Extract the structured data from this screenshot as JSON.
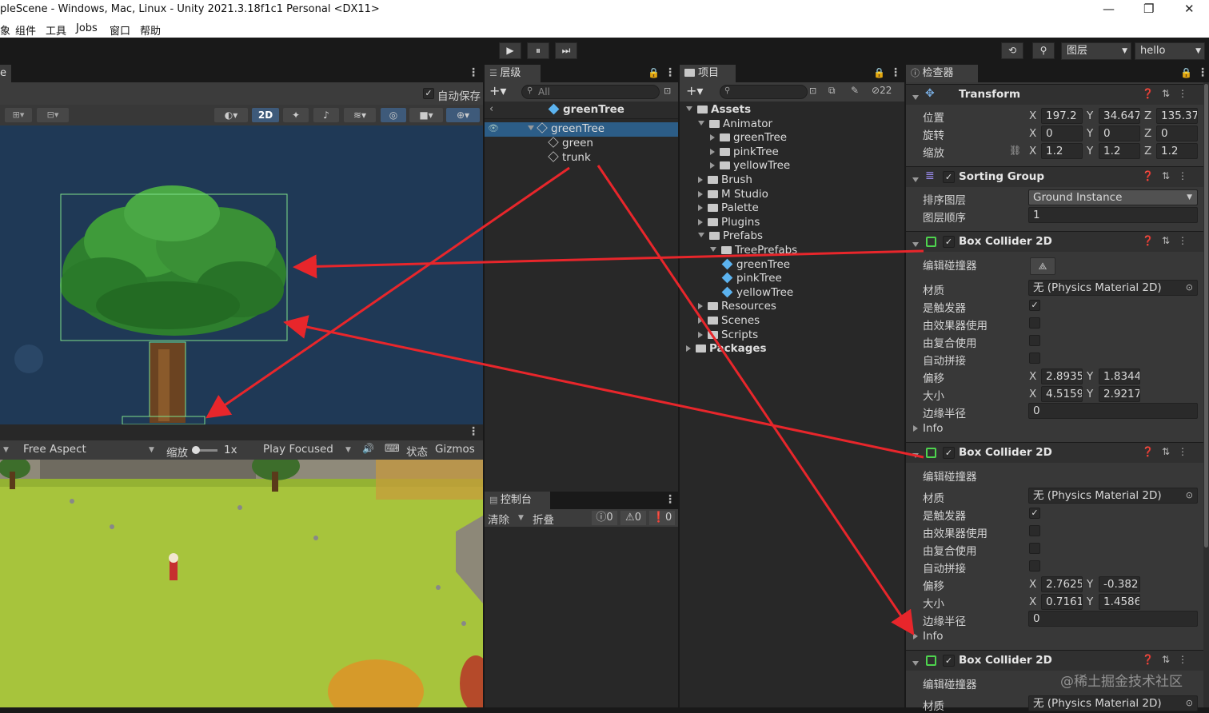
{
  "window": {
    "title": "pleScene - Windows, Mac, Linux - Unity 2021.3.18f1c1 Personal <DX11>",
    "minimize": "—",
    "restore": "❐",
    "close": "✕"
  },
  "menu": [
    "象",
    "组件",
    "工具",
    "Jobs",
    "窗口",
    "帮助"
  ],
  "toolbar": {
    "play": "▶",
    "pause": "⏸",
    "step": "⏭",
    "history": "⟲",
    "search": "⚲",
    "layers": "图层",
    "layout": "hello"
  },
  "scene": {
    "tab": "e",
    "autosave": "自动保存",
    "mode_2d": "2D"
  },
  "game": {
    "aspect": "Free Aspect",
    "scale_label": "缩放",
    "scale_value": "1x",
    "play_mode": "Play Focused",
    "stats": "状态",
    "gizmos": "Gizmos"
  },
  "hierarchy": {
    "tab": "层级",
    "search_placeholder": "All",
    "root": "greenTree",
    "items": [
      "greenTree",
      "green",
      "trunk"
    ]
  },
  "console": {
    "tab": "控制台",
    "clear": "清除",
    "collapse": "折叠",
    "info_count": "0",
    "warn_count": "0",
    "error_count": "0"
  },
  "project": {
    "tab": "项目",
    "hidden_count": "22",
    "tree": [
      {
        "label": "Assets",
        "depth": 0,
        "open": true,
        "bold": true
      },
      {
        "label": "Animator",
        "depth": 1,
        "open": true
      },
      {
        "label": "greenTree",
        "depth": 2
      },
      {
        "label": "pinkTree",
        "depth": 2
      },
      {
        "label": "yellowTree",
        "depth": 2
      },
      {
        "label": "Brush",
        "depth": 1
      },
      {
        "label": "M Studio",
        "depth": 1
      },
      {
        "label": "Palette",
        "depth": 1
      },
      {
        "label": "Plugins",
        "depth": 1
      },
      {
        "label": "Prefabs",
        "depth": 1,
        "open": true
      },
      {
        "label": "TreePrefabs",
        "depth": 2,
        "open": true
      },
      {
        "label": "greenTree",
        "depth": 3,
        "prefab": true
      },
      {
        "label": "pinkTree",
        "depth": 3,
        "prefab": true
      },
      {
        "label": "yellowTree",
        "depth": 3,
        "prefab": true
      },
      {
        "label": "Resources",
        "depth": 1
      },
      {
        "label": "Scenes",
        "depth": 1
      },
      {
        "label": "Scripts",
        "depth": 1
      },
      {
        "label": "Packages",
        "depth": 0,
        "bold": true
      }
    ]
  },
  "inspector": {
    "tab": "检查器",
    "transform": {
      "title": "Transform",
      "position_label": "位置",
      "rotation_label": "旋转",
      "scale_label": "缩放",
      "position": {
        "x": "197.2",
        "y": "34.647",
        "z": "135.37"
      },
      "rotation": {
        "x": "0",
        "y": "0",
        "z": "0"
      },
      "scale": {
        "x": "1.2",
        "y": "1.2",
        "z": "1.2"
      }
    },
    "sorting": {
      "title": "Sorting Group",
      "layer_label": "排序图层",
      "layer_value": "Ground Instance",
      "order_label": "图层顺序",
      "order_value": "1"
    },
    "labels": {
      "edit": "编辑碰撞器",
      "material": "材质",
      "trigger": "是触发器",
      "effector": "由效果器使用",
      "composite": "由复合使用",
      "tiling": "自动拼接",
      "offset": "偏移",
      "size": "大小",
      "edge": "边缘半径",
      "info": "Info",
      "x": "X",
      "y": "Y",
      "z": "Z"
    },
    "colliders": [
      {
        "title": "Box Collider 2D",
        "material": "无 (Physics Material 2D)",
        "offset_x": "2.8935",
        "offset_y": "1.8344",
        "size_x": "4.5159",
        "size_y": "2.9217",
        "edge": "0"
      },
      {
        "title": "Box Collider 2D",
        "material": "无 (Physics Material 2D)",
        "offset_x": "2.7625",
        "offset_y": "-0.382",
        "size_x": "0.7161",
        "size_y": "1.4586",
        "edge": "0"
      },
      {
        "title": "Box Collider 2D",
        "material": "无 (Physics Material 2D)"
      }
    ]
  },
  "watermark": "@稀土掘金技术社区"
}
